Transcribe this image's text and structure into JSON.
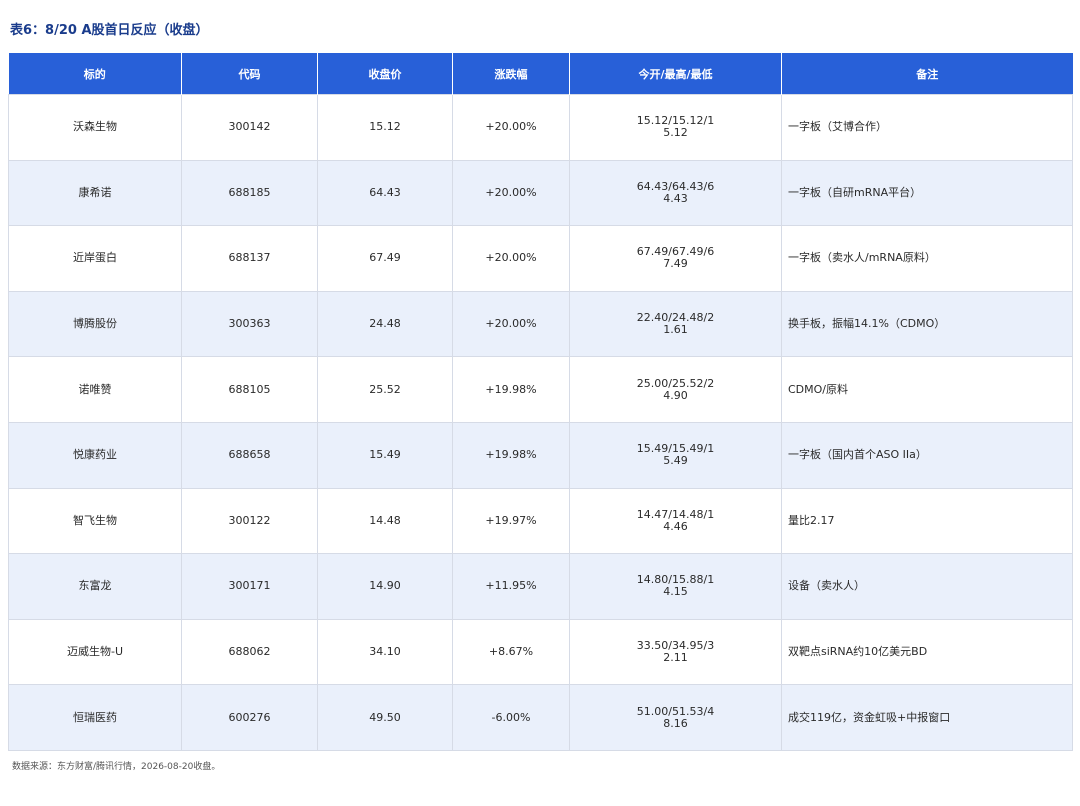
{
  "title": "表6：8/20 A股首日反应（收盘）",
  "headers": [
    "标的",
    "代码",
    "收盘价",
    "涨跌幅",
    "今开/最高/最低",
    "备注"
  ],
  "rows": [
    {
      "name": "沃森生物",
      "code": "300142",
      "close": "15.12",
      "change": "+20.00%",
      "ohl": "15.12/15.12/15.12",
      "note": "一字板（艾博合作）"
    },
    {
      "name": "康希诺",
      "code": "688185",
      "close": "64.43",
      "change": "+20.00%",
      "ohl": "64.43/64.43/64.43",
      "note": "一字板（自研mRNA平台）"
    },
    {
      "name": "近岸蛋白",
      "code": "688137",
      "close": "67.49",
      "change": "+20.00%",
      "ohl": "67.49/67.49/67.49",
      "note": "一字板（卖水人/mRNA原料）"
    },
    {
      "name": "博腾股份",
      "code": "300363",
      "close": "24.48",
      "change": "+20.00%",
      "ohl": "22.40/24.48/21.61",
      "note": "换手板，振幅14.1%（CDMO）"
    },
    {
      "name": "诺唯赞",
      "code": "688105",
      "close": "25.52",
      "change": "+19.98%",
      "ohl": "25.00/25.52/24.90",
      "note": "CDMO/原料"
    },
    {
      "name": "悦康药业",
      "code": "688658",
      "close": "15.49",
      "change": "+19.98%",
      "ohl": "15.49/15.49/15.49",
      "note": "一字板（国内首个ASO IIa）"
    },
    {
      "name": "智飞生物",
      "code": "300122",
      "close": "14.48",
      "change": "+19.97%",
      "ohl": "14.47/14.48/14.46",
      "note": "量比2.17"
    },
    {
      "name": "东富龙",
      "code": "300171",
      "close": "14.90",
      "change": "+11.95%",
      "ohl": "14.80/15.88/14.15",
      "note": "设备（卖水人）"
    },
    {
      "name": "迈威生物-U",
      "code": "688062",
      "close": "34.10",
      "change": "+8.67%",
      "ohl": "33.50/34.95/32.11",
      "note": "双靶点siRNA约10亿美元BD"
    },
    {
      "name": "恒瑞医药",
      "code": "600276",
      "close": "49.50",
      "change": "-6.00%",
      "ohl": "51.00/51.53/48.16",
      "note": "成交119亿，资金虹吸+中报窗口"
    }
  ],
  "footnote": "数据来源：东方财富/腾讯行情，2026-08-20收盘。",
  "colors": {
    "header_bg": "#2860d8",
    "title": "#1a3c8c",
    "row_alt": "#eaf0fb",
    "border": "#d6dbe6"
  }
}
